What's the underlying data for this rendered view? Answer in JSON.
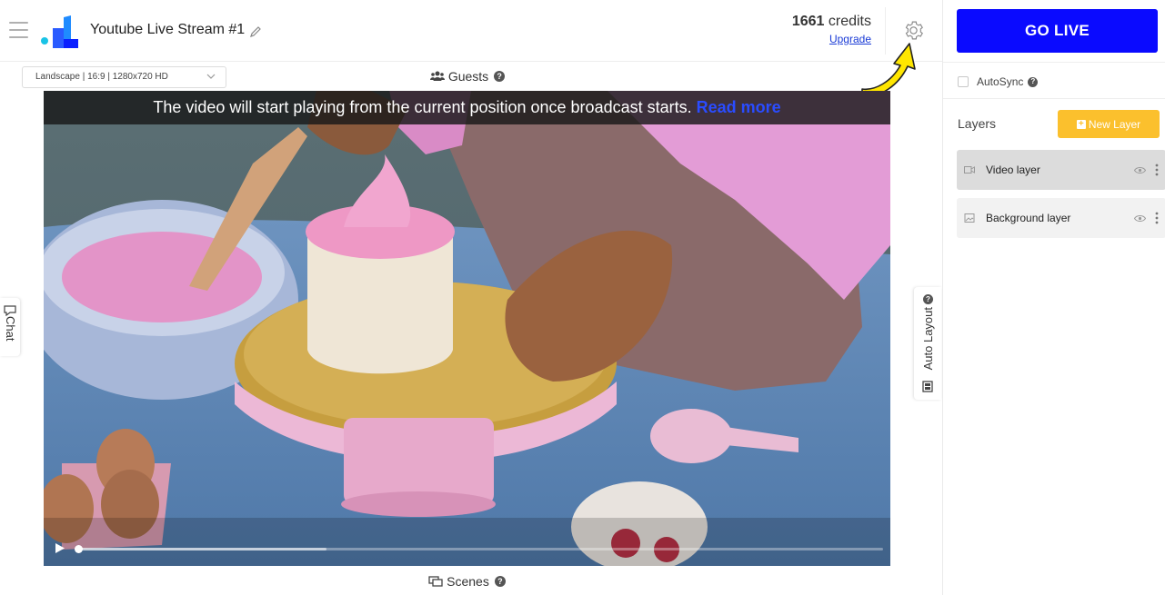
{
  "header": {
    "title": "Youtube Live Stream #1",
    "credits_value": "1661",
    "credits_label": "credits",
    "upgrade_label": "Upgrade"
  },
  "stage": {
    "aspect_selected": "Landscape | 16:9 | 1280x720 HD",
    "guests_label": "Guests",
    "scenes_label": "Scenes",
    "chat_label": "Chat",
    "auto_layout_label": "Auto Layout"
  },
  "video": {
    "notice_text": "The video will start playing from the current position once broadcast starts.",
    "read_more_label": "Read more",
    "playback_progress": 0.0,
    "buffered_fraction": 0.31
  },
  "right_panel": {
    "go_live_label": "GO LIVE",
    "autosync_label": "AutoSync",
    "layers_title": "Layers",
    "new_layer_label": "New Layer",
    "layers": [
      {
        "name": "Video layer",
        "type": "video",
        "active": true
      },
      {
        "name": "Background layer",
        "type": "image",
        "active": false
      }
    ]
  },
  "colors": {
    "go_live_bg": "#0a0aff",
    "new_layer_bg": "#fbc02d",
    "link": "#1a3bd6",
    "read_more": "#2a4cff",
    "annotation_arrow": "#ffe600"
  },
  "icons": {
    "menu": "hamburger-icon",
    "logo": "brand-logo",
    "edit": "pencil-icon",
    "settings": "gear-icon",
    "guests": "people-icon",
    "scenes": "scenes-icon",
    "chat": "chat-icon",
    "auto_layout": "layout-icon",
    "help": "help-icon",
    "visibility": "eye-icon",
    "more": "kebab-icon",
    "play": "play-icon"
  }
}
